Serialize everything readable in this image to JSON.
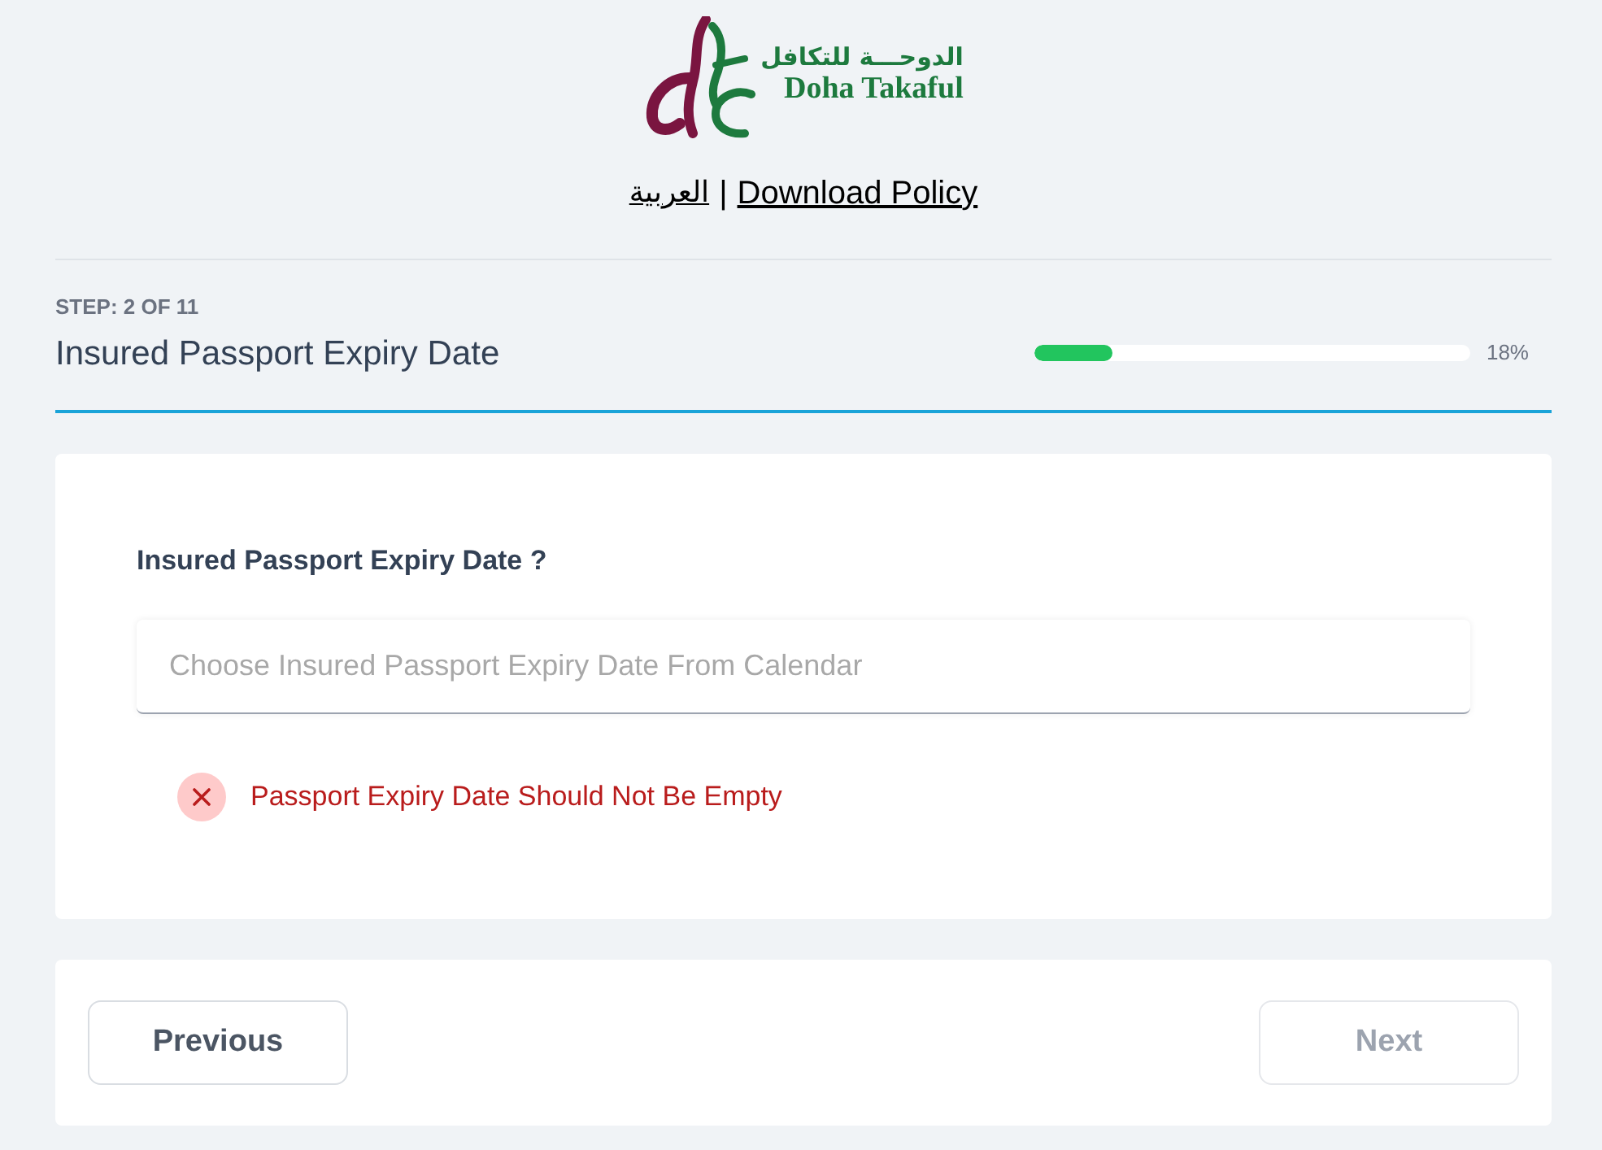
{
  "header": {
    "logo": {
      "arabic_name": "الدوحـــة للتكافل",
      "name": "Doha Takaful"
    },
    "links": [
      {
        "kind": "language",
        "label": "العربية"
      },
      {
        "kind": "download",
        "label": "Download Policy"
      }
    ],
    "separator": "|"
  },
  "step": {
    "label": "STEP: 2 OF 11",
    "title": "Insured Passport Expiry Date",
    "progress": {
      "level": 0.18,
      "reading": "18%"
    }
  },
  "question": {
    "label": "Insured Passport Expiry Date ?",
    "field": {
      "placeholder": "Choose Insured Passport Expiry Date From Calendar"
    },
    "error": "Passport Expiry Date Should Not Be Empty"
  },
  "buttons": [
    {
      "label": "Previous",
      "disabled": false
    },
    {
      "label": "Next",
      "disabled": true
    }
  ]
}
